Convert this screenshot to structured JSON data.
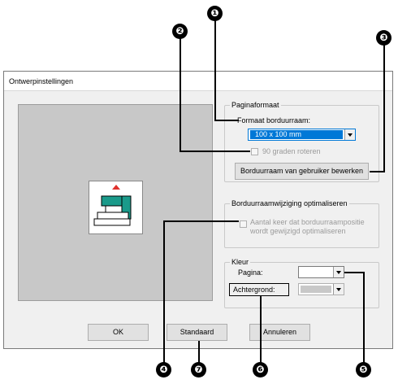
{
  "callouts": [
    "❶",
    "❷",
    "❸",
    "❹",
    "❺",
    "❻",
    "❼"
  ],
  "dialog": {
    "title": "Ontwerpinstellingen",
    "page_format": {
      "legend": "Paginaformaat",
      "hoop_label": "Formaat borduurraam:",
      "hoop_value": "100 x 100 mm",
      "rotate_label": "90 graden roteren",
      "edit_hoop_button": "Borduurraam van gebruiker bewerken"
    },
    "optimize": {
      "legend": "Borduurraamwijziging optimaliseren",
      "checkbox_label_line1": "Aantal keer dat borduurraampositie",
      "checkbox_label_line2": "wordt gewijzigd optimaliseren"
    },
    "color": {
      "legend": "Kleur",
      "page_label": "Pagina:",
      "page_color": "#ffffff",
      "background_label": "Achtergrond:",
      "background_color": "#c8c8c8"
    },
    "buttons": {
      "ok": "OK",
      "default": "Standaard",
      "cancel": "Annuleren"
    },
    "colors": {
      "selection": "#0078d7",
      "preview_bg": "#c8c8c8",
      "hoop_marker": "#e0312d",
      "machine_accent": "#1a9a8a"
    }
  }
}
